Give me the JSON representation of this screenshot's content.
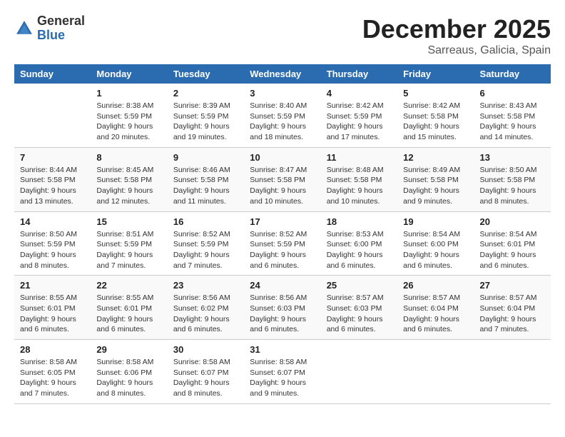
{
  "header": {
    "logo_general": "General",
    "logo_blue": "Blue",
    "month_title": "December 2025",
    "location": "Sarreaus, Galicia, Spain"
  },
  "columns": [
    "Sunday",
    "Monday",
    "Tuesday",
    "Wednesday",
    "Thursday",
    "Friday",
    "Saturday"
  ],
  "weeks": [
    [
      {
        "day": "",
        "info": ""
      },
      {
        "day": "1",
        "info": "Sunrise: 8:38 AM\nSunset: 5:59 PM\nDaylight: 9 hours\nand 20 minutes."
      },
      {
        "day": "2",
        "info": "Sunrise: 8:39 AM\nSunset: 5:59 PM\nDaylight: 9 hours\nand 19 minutes."
      },
      {
        "day": "3",
        "info": "Sunrise: 8:40 AM\nSunset: 5:59 PM\nDaylight: 9 hours\nand 18 minutes."
      },
      {
        "day": "4",
        "info": "Sunrise: 8:42 AM\nSunset: 5:59 PM\nDaylight: 9 hours\nand 17 minutes."
      },
      {
        "day": "5",
        "info": "Sunrise: 8:42 AM\nSunset: 5:58 PM\nDaylight: 9 hours\nand 15 minutes."
      },
      {
        "day": "6",
        "info": "Sunrise: 8:43 AM\nSunset: 5:58 PM\nDaylight: 9 hours\nand 14 minutes."
      }
    ],
    [
      {
        "day": "7",
        "info": "Sunrise: 8:44 AM\nSunset: 5:58 PM\nDaylight: 9 hours\nand 13 minutes."
      },
      {
        "day": "8",
        "info": "Sunrise: 8:45 AM\nSunset: 5:58 PM\nDaylight: 9 hours\nand 12 minutes."
      },
      {
        "day": "9",
        "info": "Sunrise: 8:46 AM\nSunset: 5:58 PM\nDaylight: 9 hours\nand 11 minutes."
      },
      {
        "day": "10",
        "info": "Sunrise: 8:47 AM\nSunset: 5:58 PM\nDaylight: 9 hours\nand 10 minutes."
      },
      {
        "day": "11",
        "info": "Sunrise: 8:48 AM\nSunset: 5:58 PM\nDaylight: 9 hours\nand 10 minutes."
      },
      {
        "day": "12",
        "info": "Sunrise: 8:49 AM\nSunset: 5:58 PM\nDaylight: 9 hours\nand 9 minutes."
      },
      {
        "day": "13",
        "info": "Sunrise: 8:50 AM\nSunset: 5:58 PM\nDaylight: 9 hours\nand 8 minutes."
      }
    ],
    [
      {
        "day": "14",
        "info": "Sunrise: 8:50 AM\nSunset: 5:59 PM\nDaylight: 9 hours\nand 8 minutes."
      },
      {
        "day": "15",
        "info": "Sunrise: 8:51 AM\nSunset: 5:59 PM\nDaylight: 9 hours\nand 7 minutes."
      },
      {
        "day": "16",
        "info": "Sunrise: 8:52 AM\nSunset: 5:59 PM\nDaylight: 9 hours\nand 7 minutes."
      },
      {
        "day": "17",
        "info": "Sunrise: 8:52 AM\nSunset: 5:59 PM\nDaylight: 9 hours\nand 6 minutes."
      },
      {
        "day": "18",
        "info": "Sunrise: 8:53 AM\nSunset: 6:00 PM\nDaylight: 9 hours\nand 6 minutes."
      },
      {
        "day": "19",
        "info": "Sunrise: 8:54 AM\nSunset: 6:00 PM\nDaylight: 9 hours\nand 6 minutes."
      },
      {
        "day": "20",
        "info": "Sunrise: 8:54 AM\nSunset: 6:01 PM\nDaylight: 9 hours\nand 6 minutes."
      }
    ],
    [
      {
        "day": "21",
        "info": "Sunrise: 8:55 AM\nSunset: 6:01 PM\nDaylight: 9 hours\nand 6 minutes."
      },
      {
        "day": "22",
        "info": "Sunrise: 8:55 AM\nSunset: 6:01 PM\nDaylight: 9 hours\nand 6 minutes."
      },
      {
        "day": "23",
        "info": "Sunrise: 8:56 AM\nSunset: 6:02 PM\nDaylight: 9 hours\nand 6 minutes."
      },
      {
        "day": "24",
        "info": "Sunrise: 8:56 AM\nSunset: 6:03 PM\nDaylight: 9 hours\nand 6 minutes."
      },
      {
        "day": "25",
        "info": "Sunrise: 8:57 AM\nSunset: 6:03 PM\nDaylight: 9 hours\nand 6 minutes."
      },
      {
        "day": "26",
        "info": "Sunrise: 8:57 AM\nSunset: 6:04 PM\nDaylight: 9 hours\nand 6 minutes."
      },
      {
        "day": "27",
        "info": "Sunrise: 8:57 AM\nSunset: 6:04 PM\nDaylight: 9 hours\nand 7 minutes."
      }
    ],
    [
      {
        "day": "28",
        "info": "Sunrise: 8:58 AM\nSunset: 6:05 PM\nDaylight: 9 hours\nand 7 minutes."
      },
      {
        "day": "29",
        "info": "Sunrise: 8:58 AM\nSunset: 6:06 PM\nDaylight: 9 hours\nand 8 minutes."
      },
      {
        "day": "30",
        "info": "Sunrise: 8:58 AM\nSunset: 6:07 PM\nDaylight: 9 hours\nand 8 minutes."
      },
      {
        "day": "31",
        "info": "Sunrise: 8:58 AM\nSunset: 6:07 PM\nDaylight: 9 hours\nand 9 minutes."
      },
      {
        "day": "",
        "info": ""
      },
      {
        "day": "",
        "info": ""
      },
      {
        "day": "",
        "info": ""
      }
    ]
  ]
}
